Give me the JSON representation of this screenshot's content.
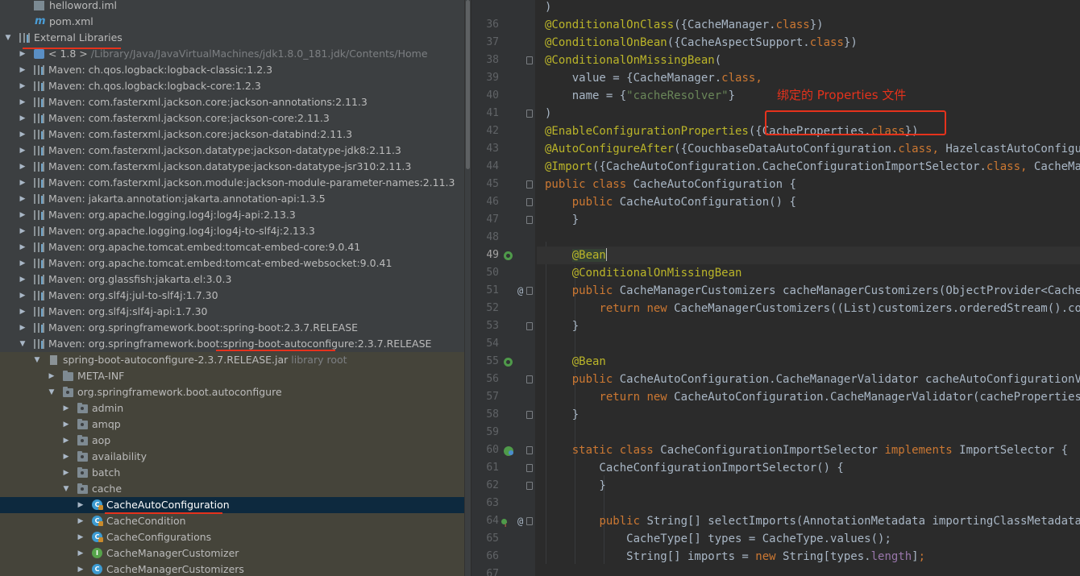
{
  "project_tree": {
    "items": [
      {
        "label": "helloword.iml",
        "icon": "iml-file-icon"
      },
      {
        "label": "pom.xml",
        "icon": "maven-file-icon"
      },
      {
        "label": "External Libraries",
        "icon": "library-icon"
      },
      {
        "label": "< 1.8 >",
        "suffix": "/Library/Java/JavaVirtualMachines/jdk1.8.0_181.jdk/Contents/Home",
        "icon": "jdk-icon"
      },
      {
        "label": "Maven: ch.qos.logback:logback-classic:1.2.3"
      },
      {
        "label": "Maven: ch.qos.logback:logback-core:1.2.3"
      },
      {
        "label": "Maven: com.fasterxml.jackson.core:jackson-annotations:2.11.3"
      },
      {
        "label": "Maven: com.fasterxml.jackson.core:jackson-core:2.11.3"
      },
      {
        "label": "Maven: com.fasterxml.jackson.core:jackson-databind:2.11.3"
      },
      {
        "label": "Maven: com.fasterxml.jackson.datatype:jackson-datatype-jdk8:2.11.3"
      },
      {
        "label": "Maven: com.fasterxml.jackson.datatype:jackson-datatype-jsr310:2.11.3"
      },
      {
        "label": "Maven: com.fasterxml.jackson.module:jackson-module-parameter-names:2.11.3"
      },
      {
        "label": "Maven: jakarta.annotation:jakarta.annotation-api:1.3.5"
      },
      {
        "label": "Maven: org.apache.logging.log4j:log4j-api:2.13.3"
      },
      {
        "label": "Maven: org.apache.logging.log4j:log4j-to-slf4j:2.13.3"
      },
      {
        "label": "Maven: org.apache.tomcat.embed:tomcat-embed-core:9.0.41"
      },
      {
        "label": "Maven: org.apache.tomcat.embed:tomcat-embed-websocket:9.0.41"
      },
      {
        "label": "Maven: org.glassfish:jakarta.el:3.0.3"
      },
      {
        "label": "Maven: org.slf4j:jul-to-slf4j:1.7.30"
      },
      {
        "label": "Maven: org.slf4j:slf4j-api:1.7.30"
      },
      {
        "label": "Maven: org.springframework.boot:spring-boot:2.3.7.RELEASE"
      },
      {
        "label": "Maven: org.springframework.boot:spring-boot-autoconfigure:2.3.7.RELEASE"
      },
      {
        "label": "spring-boot-autoconfigure-2.3.7.RELEASE.jar",
        "suffix": "library root",
        "icon": "jar-icon"
      },
      {
        "label": "META-INF",
        "icon": "folder-icon"
      },
      {
        "label": "org.springframework.boot.autoconfigure",
        "icon": "package-icon"
      },
      {
        "label": "admin",
        "icon": "package-icon"
      },
      {
        "label": "amqp",
        "icon": "package-icon"
      },
      {
        "label": "aop",
        "icon": "package-icon"
      },
      {
        "label": "availability",
        "icon": "package-icon"
      },
      {
        "label": "batch",
        "icon": "package-icon"
      },
      {
        "label": "cache",
        "icon": "package-icon"
      },
      {
        "label": "CacheAutoConfiguration",
        "icon": "class-icon"
      },
      {
        "label": "CacheCondition",
        "icon": "class-icon"
      },
      {
        "label": "CacheConfigurations",
        "icon": "class-icon"
      },
      {
        "label": "CacheManagerCustomizer",
        "icon": "interface-icon"
      },
      {
        "label": "CacheManagerCustomizers",
        "icon": "class-icon"
      }
    ]
  },
  "editor": {
    "annotation_note": "绑定的 Properties 文件",
    "current_line": 49,
    "lines": [
      {
        "n": "",
        "tokens": [
          [
            "",
            ")"
          ]
        ]
      },
      {
        "n": "36",
        "tokens": [
          [
            "ann",
            "@ConditionalOnClass"
          ],
          [
            "",
            "({CacheManager."
          ],
          [
            "kw",
            "class"
          ],
          [
            "",
            "})"
          ]
        ]
      },
      {
        "n": "37",
        "tokens": [
          [
            "ann",
            "@ConditionalOnBean"
          ],
          [
            "",
            "({CacheAspectSupport."
          ],
          [
            "kw",
            "class"
          ],
          [
            "",
            "})"
          ]
        ]
      },
      {
        "n": "38",
        "tokens": [
          [
            "ann",
            "@ConditionalOnMissingBean"
          ],
          [
            "",
            "("
          ]
        ]
      },
      {
        "n": "39",
        "tokens": [
          [
            "",
            "    value = {CacheManager."
          ],
          [
            "kw",
            "class"
          ],
          [
            "kw",
            ","
          ]
        ]
      },
      {
        "n": "40",
        "tokens": [
          [
            "",
            "    name = {"
          ],
          [
            "str",
            "\"cacheResolver\""
          ],
          [
            "",
            "}"
          ]
        ]
      },
      {
        "n": "41",
        "tokens": [
          [
            "",
            ")"
          ]
        ]
      },
      {
        "n": "42",
        "tokens": [
          [
            "ann",
            "@EnableConfigurationProperties"
          ],
          [
            "",
            "({CacheProperties."
          ],
          [
            "kw",
            "class"
          ],
          [
            "",
            "})"
          ]
        ]
      },
      {
        "n": "43",
        "tokens": [
          [
            "ann",
            "@AutoConfigureAfter"
          ],
          [
            "",
            "({CouchbaseDataAutoConfiguration."
          ],
          [
            "kw",
            "class"
          ],
          [
            "kw",
            ", "
          ],
          [
            "",
            "HazelcastAutoConfiguration."
          ],
          [
            "kw",
            "class"
          ]
        ]
      },
      {
        "n": "44",
        "tokens": [
          [
            "ann",
            "@Import"
          ],
          [
            "",
            "({CacheAutoConfiguration.CacheConfigurationImportSelector."
          ],
          [
            "kw",
            "class"
          ],
          [
            "kw",
            ", "
          ],
          [
            "",
            "CacheManagerEntityManagerFactoryDependsOnPostProcessor."
          ],
          [
            "kw",
            "class"
          ]
        ]
      },
      {
        "n": "45",
        "tokens": [
          [
            "kw",
            "public class "
          ],
          [
            "",
            "CacheAutoConfiguration {"
          ]
        ]
      },
      {
        "n": "46",
        "tokens": [
          [
            "",
            "    "
          ],
          [
            "kw",
            "public "
          ],
          [
            "",
            "CacheAutoConfiguration() {"
          ]
        ]
      },
      {
        "n": "47",
        "tokens": [
          [
            "",
            "    }"
          ]
        ]
      },
      {
        "n": "48",
        "tokens": [
          [
            "",
            ""
          ]
        ]
      },
      {
        "n": "49",
        "tokens": [
          [
            "",
            "    "
          ],
          [
            "ann bean-bg",
            "@Bean"
          ]
        ]
      },
      {
        "n": "50",
        "tokens": [
          [
            "",
            "    "
          ],
          [
            "ann",
            "@ConditionalOnMissingBean"
          ]
        ]
      },
      {
        "n": "51",
        "tokens": [
          [
            "",
            "    "
          ],
          [
            "kw",
            "public "
          ],
          [
            "",
            "CacheManagerCustomizers cacheManagerCustomizers(ObjectProvider<CacheManagerCustomizer<?>> customizers) {"
          ]
        ]
      },
      {
        "n": "52",
        "tokens": [
          [
            "",
            "        "
          ],
          [
            "kw",
            "return new "
          ],
          [
            "",
            "CacheManagerCustomizers((List)customizers.orderedStream().collect(Collectors.toList()));"
          ]
        ]
      },
      {
        "n": "53",
        "tokens": [
          [
            "",
            "    }"
          ]
        ]
      },
      {
        "n": "54",
        "tokens": [
          [
            "",
            ""
          ]
        ]
      },
      {
        "n": "55",
        "tokens": [
          [
            "",
            "    "
          ],
          [
            "ann",
            "@Bean"
          ]
        ]
      },
      {
        "n": "56",
        "tokens": [
          [
            "",
            "    "
          ],
          [
            "kw",
            "public "
          ],
          [
            "",
            "CacheAutoConfiguration.CacheManagerValidator cacheAutoConfigurationValidator("
          ]
        ]
      },
      {
        "n": "57",
        "tokens": [
          [
            "",
            "        "
          ],
          [
            "kw",
            "return new "
          ],
          [
            "",
            "CacheAutoConfiguration.CacheManagerValidator(cacheProperties, cacheManager);"
          ]
        ]
      },
      {
        "n": "58",
        "tokens": [
          [
            "",
            "    }"
          ]
        ]
      },
      {
        "n": "59",
        "tokens": [
          [
            "",
            ""
          ]
        ]
      },
      {
        "n": "60",
        "tokens": [
          [
            "",
            "    "
          ],
          [
            "kw",
            "static class "
          ],
          [
            "",
            "CacheConfigurationImportSelector "
          ],
          [
            "kw",
            "implements "
          ],
          [
            "",
            "ImportSelector {"
          ]
        ]
      },
      {
        "n": "61",
        "tokens": [
          [
            "",
            "        CacheConfigurationImportSelector() {"
          ]
        ]
      },
      {
        "n": "62",
        "tokens": [
          [
            "",
            "        }"
          ]
        ]
      },
      {
        "n": "63",
        "tokens": [
          [
            "",
            ""
          ]
        ]
      },
      {
        "n": "64",
        "tokens": [
          [
            "",
            "        "
          ],
          [
            "kw",
            "public "
          ],
          [
            "",
            "String[] selectImports(AnnotationMetadata importingClassMetadata) {"
          ]
        ]
      },
      {
        "n": "65",
        "tokens": [
          [
            "",
            "            CacheType[] types = CacheType."
          ],
          [
            "",
            "values"
          ],
          [
            "",
            "();"
          ]
        ]
      },
      {
        "n": "66",
        "tokens": [
          [
            "",
            "            String[] imports = "
          ],
          [
            "kw",
            "new "
          ],
          [
            "",
            "String[types."
          ],
          [
            "fld",
            "length"
          ],
          [
            "",
            "]"
          ],
          [
            "kw",
            ";"
          ]
        ]
      },
      {
        "n": "67",
        "tokens": [
          [
            "",
            ""
          ]
        ]
      }
    ]
  }
}
